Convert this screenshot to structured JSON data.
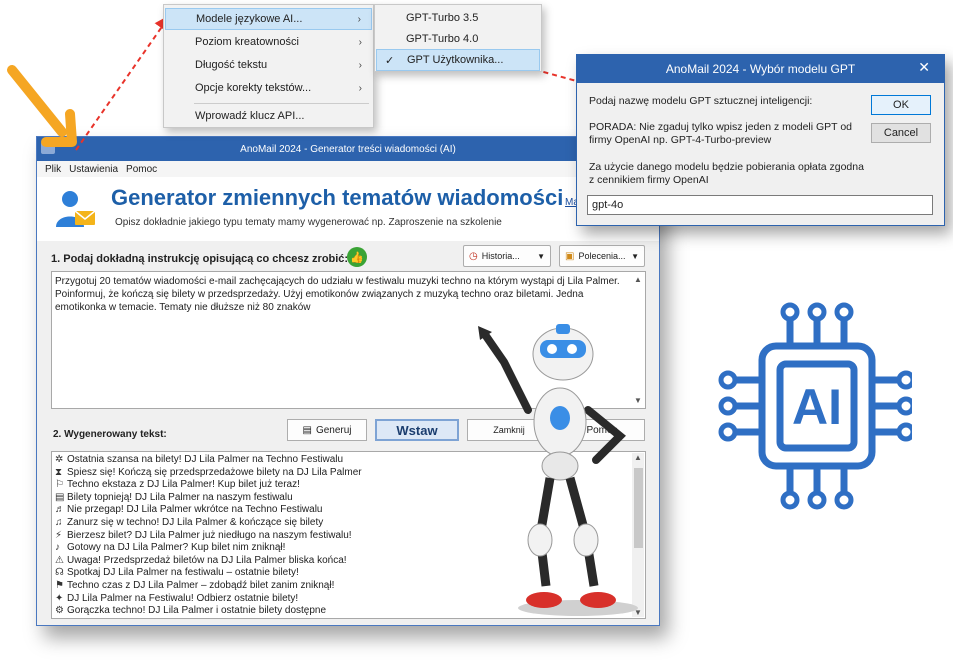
{
  "window": {
    "title": "AnoMail 2024 - Generator treści wiadomości (AI)"
  },
  "menubar": [
    "Plik",
    "Ustawienia",
    "Pomoc"
  ],
  "header": {
    "title": "Generator zmiennych tematów wiadomości",
    "subtitle": "Opisz dokładnie jakiego typu tematy mamy wygenerować np. Zaproszenie na szkolenie",
    "link": "Ma"
  },
  "section1": {
    "label": "1. Podaj dokładną instrukcję opisującą co chcesz zrobić:",
    "history_button": "Historia...",
    "commands_button": "Polecenia...",
    "instruction": "Przygotuj 20 tematów wiadomości e-mail zachęcających do udziału w festiwalu muzyki techno na którym wystąpi dj Lila Palmer. Poinformuj, że kończą się bilety w przedsprzedaży. Użyj emotikonów związanych z muzyką techno oraz biletami. Jedna emotikonka w temacie. Tematy nie dłuższe niż 80 znaków"
  },
  "section2": {
    "label": "2. Wygenerowany tekst:",
    "generate_button": "Generuj",
    "insert_button": "Wstaw",
    "close_button": "Zamknij",
    "help_button": "Pomoc"
  },
  "generated_items": [
    {
      "icon": "✲",
      "text": "Ostatnia szansa na bilety! DJ Lila Palmer na Techno Festiwalu"
    },
    {
      "icon": "⧗",
      "text": "Spiesz się! Kończą się przedsprzedażowe bilety na DJ Lila Palmer"
    },
    {
      "icon": "⚐",
      "text": "Techno ekstaza z DJ Lila Palmer! Kup bilet już teraz!"
    },
    {
      "icon": "▤",
      "text": "Bilety topnieją! DJ Lila Palmer na naszym festiwalu"
    },
    {
      "icon": "♬",
      "text": "Nie przegap! DJ Lila Palmer wkrótce na Techno Festiwalu"
    },
    {
      "icon": "♫",
      "text": "Zanurz się w techno! DJ Lila Palmer & kończące się bilety"
    },
    {
      "icon": "⚡",
      "text": "Bierzesz bilet? DJ Lila Palmer już niedługo na naszym festiwalu!"
    },
    {
      "icon": "♪",
      "text": "Gotowy na DJ Lila Palmer? Kup bilet nim zniknął!"
    },
    {
      "icon": "⚠",
      "text": "Uwaga! Przedsprzedaż biletów na DJ Lila Palmer bliska końca!"
    },
    {
      "icon": "☊",
      "text": "Spotkaj DJ Lila Palmer na festiwalu – ostatnie bilety!"
    },
    {
      "icon": "⚑",
      "text": "Techno czas z DJ Lila Palmer – zdobądź bilet zanim zniknął!"
    },
    {
      "icon": "✦",
      "text": "DJ Lila Palmer na Festiwalu! Odbierz ostatnie bilety!"
    },
    {
      "icon": "⚙",
      "text": "Gorączka techno! DJ Lila Palmer i ostatnie bilety dostępne"
    }
  ],
  "menu": {
    "items": [
      {
        "label": "Modele językowe AI...",
        "submenu": true,
        "highlighted": true
      },
      {
        "label": "Poziom kreatowności",
        "submenu": true
      },
      {
        "label": "Długość tekstu",
        "submenu": true
      },
      {
        "label": "Opcje korekty tekstów...",
        "submenu": true
      },
      {
        "label": "Wprowadź klucz API...",
        "submenu": false
      }
    ]
  },
  "submenu": {
    "items": [
      {
        "label": "GPT-Turbo 3.5",
        "checked": false
      },
      {
        "label": "GPT-Turbo 4.0",
        "checked": false
      },
      {
        "label": "GPT Użytkownika...",
        "checked": true
      }
    ]
  },
  "dialog": {
    "title": "AnoMail 2024 - Wybór modelu GPT",
    "prompt": "Podaj nazwę modelu GPT sztucznej inteligencji:",
    "hint": "PORADA: Nie zgaduj tylko wpisz jeden z modeli GPT od firmy OpenAI np. GPT-4-Turbo-preview",
    "fee": "Za użycie danego modelu będzie pobierania opłata zgodna z cennikiem firmy OpenAI",
    "ok": "OK",
    "cancel": "Cancel",
    "value": "gpt-4o"
  },
  "ai_chip_label": "AI",
  "colors": {
    "accent": "#2d63ae",
    "arrow": "#e8332a",
    "chip": "#2f6fc4",
    "highlight_arrow": "#f5a623"
  }
}
